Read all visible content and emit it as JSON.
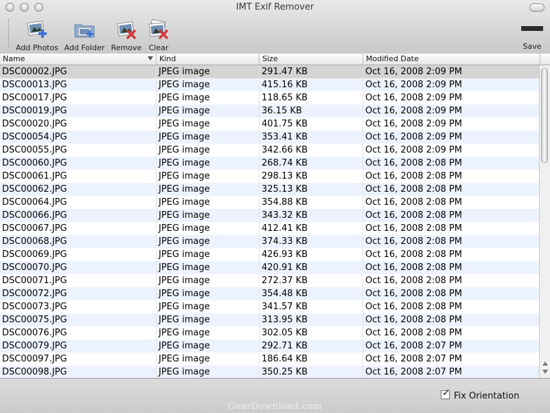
{
  "window": {
    "title": "IMT Exif Remover"
  },
  "toolbar": {
    "add_photos": "Add Photos",
    "add_folder": "Add Folder",
    "remove": "Remove",
    "clear": "Clear",
    "save": "Save"
  },
  "table": {
    "columns": [
      "Name",
      "Kind",
      "Size",
      "Modified Date"
    ],
    "rows": [
      [
        "DSC00002.JPG",
        "JPEG image",
        "291.47 KB",
        "Oct 16, 2008 2:09 PM"
      ],
      [
        "DSC00013.JPG",
        "JPEG image",
        "415.16 KB",
        "Oct 16, 2008 2:09 PM"
      ],
      [
        "DSC00017.JPG",
        "JPEG image",
        "118.65 KB",
        "Oct 16, 2008 2:09 PM"
      ],
      [
        "DSC00019.JPG",
        "JPEG image",
        "36.15 KB",
        "Oct 16, 2008 2:09 PM"
      ],
      [
        "DSC00020.JPG",
        "JPEG image",
        "401.75 KB",
        "Oct 16, 2008 2:09 PM"
      ],
      [
        "DSC00054.JPG",
        "JPEG image",
        "353.41 KB",
        "Oct 16, 2008 2:09 PM"
      ],
      [
        "DSC00055.JPG",
        "JPEG image",
        "342.66 KB",
        "Oct 16, 2008 2:09 PM"
      ],
      [
        "DSC00060.JPG",
        "JPEG image",
        "268.74 KB",
        "Oct 16, 2008 2:08 PM"
      ],
      [
        "DSC00061.JPG",
        "JPEG image",
        "298.13 KB",
        "Oct 16, 2008 2:08 PM"
      ],
      [
        "DSC00062.JPG",
        "JPEG image",
        "325.13 KB",
        "Oct 16, 2008 2:08 PM"
      ],
      [
        "DSC00064.JPG",
        "JPEG image",
        "354.88 KB",
        "Oct 16, 2008 2:08 PM"
      ],
      [
        "DSC00066.JPG",
        "JPEG image",
        "343.32 KB",
        "Oct 16, 2008 2:08 PM"
      ],
      [
        "DSC00067.JPG",
        "JPEG image",
        "412.41 KB",
        "Oct 16, 2008 2:08 PM"
      ],
      [
        "DSC00068.JPG",
        "JPEG image",
        "374.33 KB",
        "Oct 16, 2008 2:08 PM"
      ],
      [
        "DSC00069.JPG",
        "JPEG image",
        "426.93 KB",
        "Oct 16, 2008 2:08 PM"
      ],
      [
        "DSC00070.JPG",
        "JPEG image",
        "420.91 KB",
        "Oct 16, 2008 2:08 PM"
      ],
      [
        "DSC00071.JPG",
        "JPEG image",
        "272.37 KB",
        "Oct 16, 2008 2:08 PM"
      ],
      [
        "DSC00072.JPG",
        "JPEG image",
        "354.48 KB",
        "Oct 16, 2008 2:08 PM"
      ],
      [
        "DSC00073.JPG",
        "JPEG image",
        "341.57 KB",
        "Oct 16, 2008 2:08 PM"
      ],
      [
        "DSC00075.JPG",
        "JPEG image",
        "313.95 KB",
        "Oct 16, 2008 2:08 PM"
      ],
      [
        "DSC00076.JPG",
        "JPEG image",
        "302.05 KB",
        "Oct 16, 2008 2:08 PM"
      ],
      [
        "DSC00079.JPG",
        "JPEG image",
        "292.71 KB",
        "Oct 16, 2008 2:07 PM"
      ],
      [
        "DSC00097.JPG",
        "JPEG image",
        "186.64 KB",
        "Oct 16, 2008 2:07 PM"
      ],
      [
        "DSC00098.JPG",
        "JPEG image",
        "350.25 KB",
        "Oct 16, 2008 2:07 PM"
      ]
    ]
  },
  "footer": {
    "fix_orientation_label": "Fix Orientation",
    "fix_orientation_checked": true,
    "watermark": "GearDownload.com"
  },
  "icons": {
    "add_photos": "photo-plus-icon",
    "add_folder": "folder-photo-icon",
    "remove": "photo-remove-icon",
    "clear": "photos-clear-icon",
    "save": "save-bar-icon"
  },
  "colors": {
    "row_alternate": "#edf3fe",
    "row_selected": "#d4d4d4",
    "plus_blue": "#3f73d8",
    "remove_red": "#d33a3a"
  }
}
